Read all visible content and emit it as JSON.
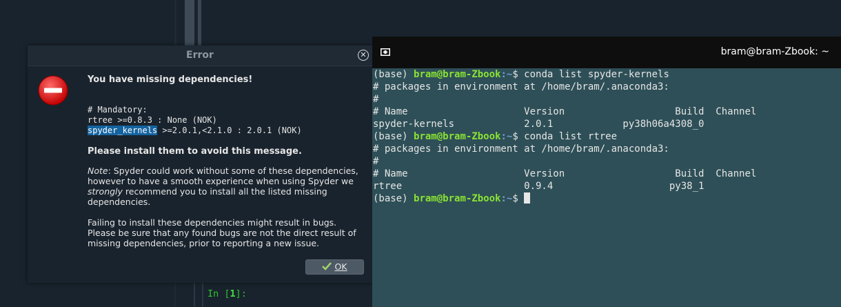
{
  "dialog": {
    "title": "Error",
    "heading": "You have missing dependencies!",
    "mandatory_label": "# Mandatory:",
    "dep1": "rtree >=0.8.3 : None (NOK)",
    "dep2_name": "spyder_kernels",
    "dep2_rest": " >=2.0.1,<2.1.0 : 2.0.1 (NOK)",
    "instruction": "Please install them to avoid this message.",
    "note_label": "Note",
    "note_text_1": ": Spyder could work without some of these dependencies, however to have a smooth experience when using Spyder we ",
    "note_emph": "strongly",
    "note_text_2": " recommend you to install all the listed missing dependencies.",
    "failing_text": "Failing to install these dependencies might result in bugs. Please be sure that any found bugs are not the direct result of missing dependencies, prior to reporting a new issue.",
    "ok_label": "OK"
  },
  "console": {
    "prompt_in": "In [",
    "prompt_num": "1",
    "prompt_end": "]:"
  },
  "terminal": {
    "window_title": "bram@bram-Zbook: ~",
    "env": "(base) ",
    "user": "bram@bram-Zbook",
    "path": ":~",
    "dollar": "$",
    "cmd1": " conda list spyder-kernels",
    "env_line": "# packages in environment at /home/bram/.anaconda3:",
    "hash": "#",
    "header": "# Name                    Version                   Build  Channel",
    "row1": "spyder-kernels            2.0.1            py38h06a4308_0",
    "cmd2": " conda list rtree",
    "row2": "rtree                     0.9.4                    py38_1"
  },
  "colors": {
    "terminal_bg": "#2e4f57",
    "user": "#8ae234",
    "path": "#729fcf"
  }
}
